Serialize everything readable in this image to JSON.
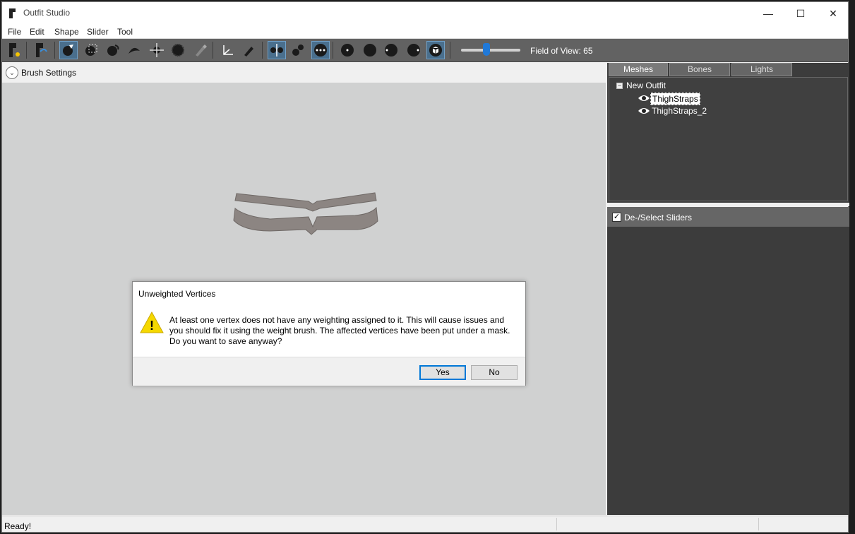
{
  "window": {
    "title": "Outfit Studio",
    "minimize_glyph": "—",
    "maximize_glyph": "☐",
    "close_glyph": "✕"
  },
  "menu": [
    "File",
    "Edit",
    "Shape",
    "Slider",
    "Tool"
  ],
  "toolbar": {
    "field_of_view_label": "Field of View: 65",
    "field_of_view_value": 65,
    "active_color": "#4a6f8d",
    "icons": [
      "new-project-icon",
      "load-project-icon",
      "select-brush-icon",
      "mask-brush-icon",
      "inflate-brush-icon",
      "deflate-brush-icon",
      "move-brush-icon",
      "smooth-brush-icon",
      "weight-brush-icon",
      "transform-icon",
      "pivot-icon",
      "mirror-x-icon",
      "mirror-y-icon",
      "mirror-z-icon",
      "vertex-size-small-icon",
      "vertex-size-large-icon",
      "vertex-dot-icon",
      "vertex-dot-2-icon",
      "cube-view-icon"
    ]
  },
  "brush_settings": {
    "label": "Brush Settings",
    "toggle_glyph": "⌄"
  },
  "viewport": {
    "background": "#d0d1d1",
    "mesh_color": "#8c8582"
  },
  "right_panel": {
    "tabs": [
      "Meshes",
      "Bones",
      "Lights"
    ],
    "tree": {
      "collapse_glyph": "−",
      "root": "New Outfit",
      "items": [
        "ThighStraps",
        "ThighStraps_2"
      ]
    },
    "sliders_header": "De-/Select Sliders",
    "sliders_checked": "✓"
  },
  "status": {
    "text": "Ready!"
  },
  "dialog": {
    "title": "Unweighted Vertices",
    "message": "At least one vertex does not have any weighting assigned to it. This will cause issues and you should fix it using the weight brush. The affected vertices have been put under a mask. Do you want to save anyway?",
    "warning_glyph": "!",
    "yes_label": "Yes",
    "no_label": "No"
  }
}
